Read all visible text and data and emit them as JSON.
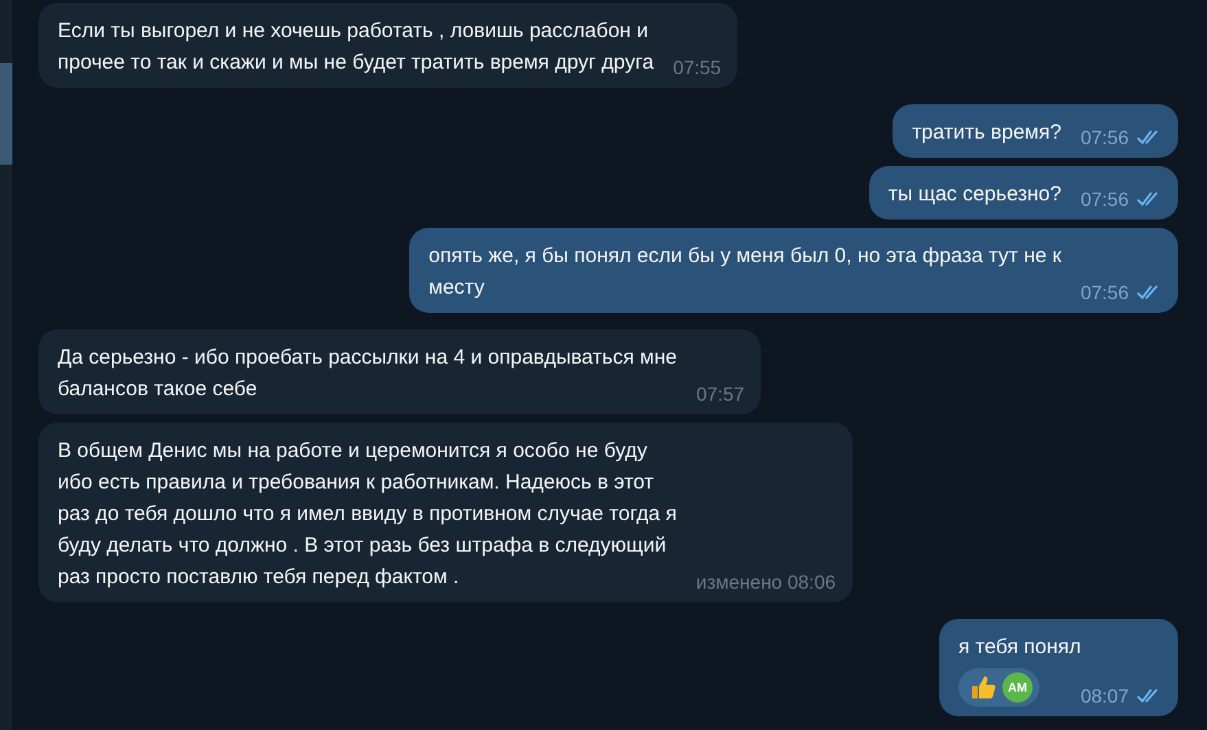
{
  "messages": [
    {
      "kind": "incoming",
      "text": "Если ты выгорел и не хочешь работать , ловишь расслабон и\nпрочее то так и скажи и мы не будет тратить время друг друга",
      "time": "07:55"
    },
    {
      "kind": "outgoing",
      "text": "тратить время?",
      "time": "07:56",
      "read": true
    },
    {
      "kind": "outgoing",
      "text": "ты щас серьезно?",
      "time": "07:56",
      "read": true
    },
    {
      "kind": "outgoing",
      "text": "опять же, я бы понял если бы у меня был 0, но эта фраза тут не к\nместу",
      "time": "07:56",
      "read": true
    },
    {
      "kind": "incoming",
      "text": "Да серьезно - ибо проебать рассылки на 4 и оправдываться мне\nбалансов такое себе",
      "time": "07:57"
    },
    {
      "kind": "incoming",
      "text": "В общем Денис мы на работе и церемонится я особо не буду\nибо есть правила и требования к работникам. Надеюсь в этот\nраз до тебя дошло что я имел ввиду в противном случае тогда я\nбуду делать что должно . В этот разь без штрафа  в следующий\nраз просто поставлю тебя перед фактом .",
      "edited": "изменено",
      "time": "08:06"
    },
    {
      "kind": "outgoing",
      "text": "я тебя понял",
      "time": "08:07",
      "read": true,
      "reactions": [
        {
          "avatar": "AM"
        }
      ]
    }
  ]
}
